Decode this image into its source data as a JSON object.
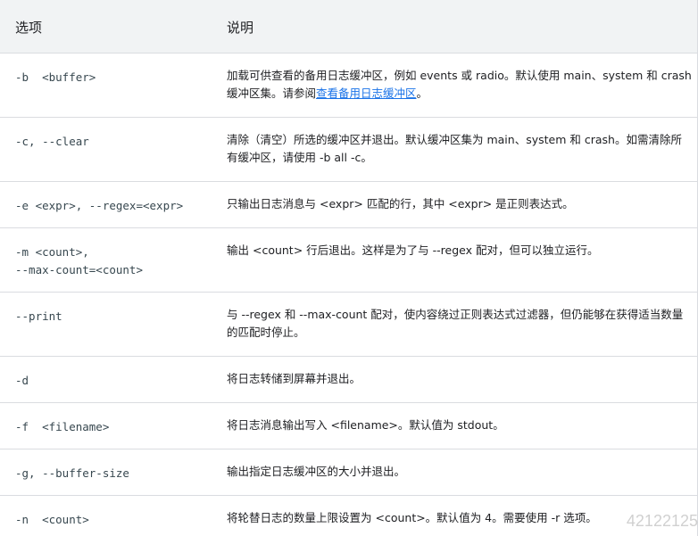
{
  "header": {
    "option": "选项",
    "description": "说明"
  },
  "rows": [
    {
      "option": "-b  <buffer>",
      "desc_before": "加载可供查看的备用日志缓冲区，例如 events 或 radio。默认使用 main、system 和 crash 缓冲区集。请参阅",
      "desc_link": "查看备用日志缓冲区",
      "desc_after": "。"
    },
    {
      "option": "-c, --clear",
      "desc": "清除（清空）所选的缓冲区并退出。默认缓冲区集为 main、system 和 crash。如需清除所有缓冲区，请使用 -b all -c。"
    },
    {
      "option": "-e <expr>, --regex=<expr>",
      "desc": "只输出日志消息与 <expr> 匹配的行，其中 <expr> 是正则表达式。"
    },
    {
      "option": "-m <count>,\n--max-count=<count>",
      "desc": "输出 <count> 行后退出。这样是为了与 --regex 配对，但可以独立运行。"
    },
    {
      "option": "--print",
      "desc": "与 --regex 和 --max-count 配对，使内容绕过正则表达式过滤器，但仍能够在获得适当数量的匹配时停止。"
    },
    {
      "option": "-d",
      "desc": "将日志转储到屏幕并退出。"
    },
    {
      "option": "-f  <filename>",
      "desc": "将日志消息输出写入 <filename>。默认值为 stdout。"
    },
    {
      "option": "-g, --buffer-size",
      "desc": "输出指定日志缓冲区的大小并退出。"
    },
    {
      "option": "-n  <count>",
      "desc": "将轮替日志的数量上限设置为 <count>。默认值为 4。需要使用 -r 选项。"
    }
  ],
  "watermark": "42122125"
}
